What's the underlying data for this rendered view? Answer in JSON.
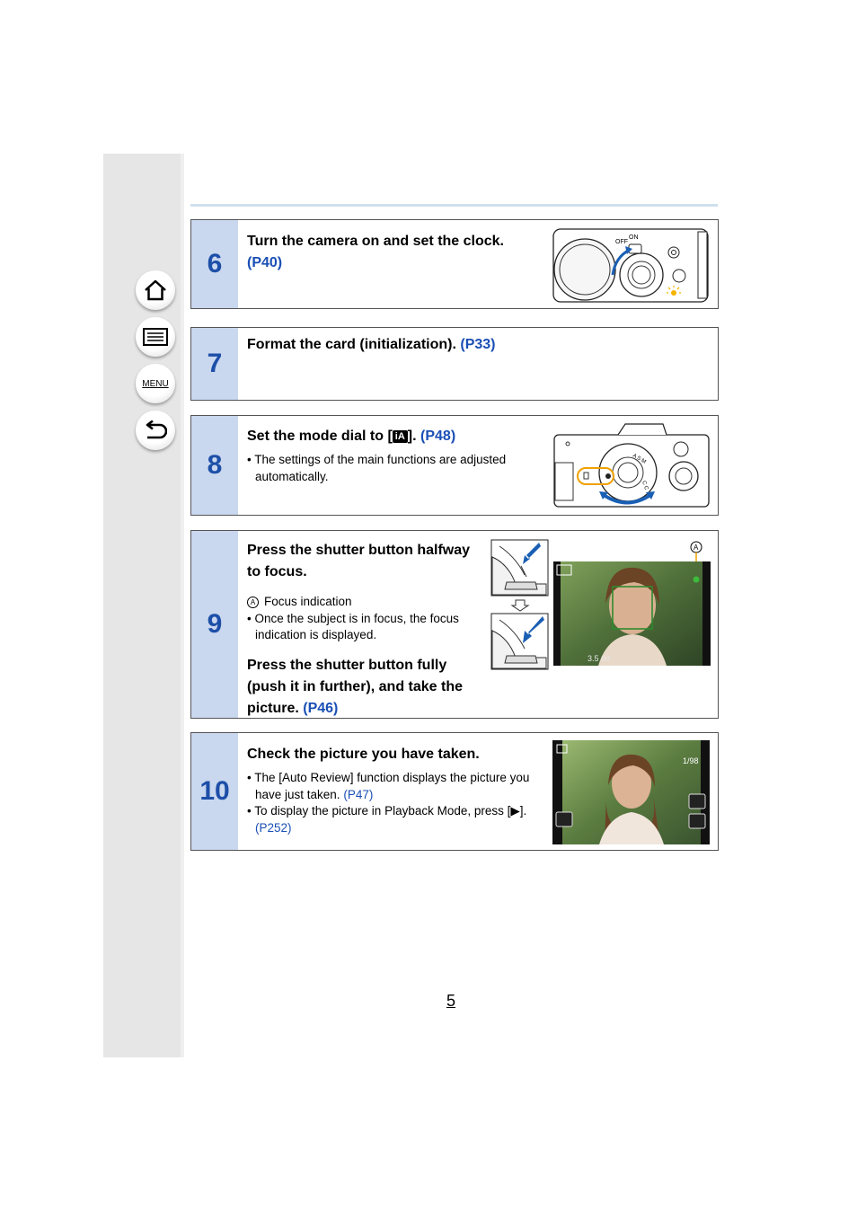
{
  "nav": {
    "home_icon": "home-icon",
    "contents_icon": "list-icon",
    "menu_label": "MENU",
    "back_icon": "return-arrow-icon"
  },
  "steps": [
    {
      "number": "6",
      "heading": "Turn the camera on and set the clock.",
      "link": "(P40)",
      "illustration": "camera-power-switch-illustration",
      "switch_labels": [
        "OFF",
        "ON"
      ]
    },
    {
      "number": "7",
      "heading": "Format the card (initialization).",
      "link": "(P33)"
    },
    {
      "number": "8",
      "heading_pre": "Set the mode dial to [",
      "heading_icon": "iA",
      "heading_post": "].",
      "link": "(P48)",
      "bullets": [
        "The settings of the main functions are adjusted automatically."
      ],
      "illustration": "mode-dial-illustration"
    },
    {
      "number": "9",
      "heading1": "Press the shutter button halfway to focus.",
      "callout_marker": "A",
      "callout_text": "Focus indication",
      "bullets": [
        "Once the subject is in focus, the focus indication is displayed."
      ],
      "heading2": "Press the shutter button fully (push it in further), and take the picture.",
      "link": "(P46)",
      "screen_readout": "3.5 60"
    },
    {
      "number": "10",
      "heading": "Check the picture you have taken.",
      "bullet1_text": "The [Auto Review] function displays the picture you have just taken.",
      "bullet1_link": "(P47)",
      "bullet2_text": "To display the picture in Playback Mode, press [▶].",
      "bullet2_link": "(P252)",
      "screen_counter": "1/98"
    }
  ],
  "page_number": "5",
  "colors": {
    "step_band": "#c9d7ef",
    "step_number": "#1d4fa8",
    "link": "#1a4fb5",
    "sidebar": "#e6e6e6"
  }
}
